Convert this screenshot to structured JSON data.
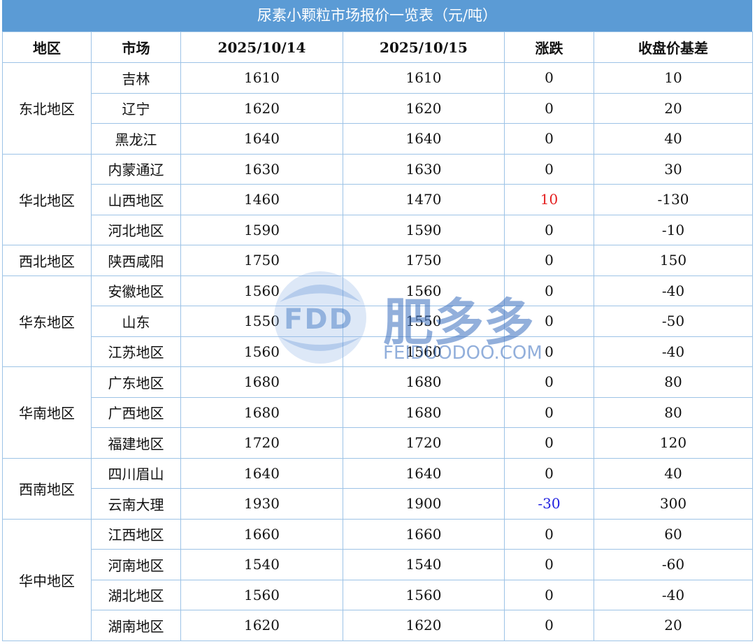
{
  "title": "尿素小颗粒市场报价一览表（元/吨）",
  "headers": [
    "地区",
    "市场",
    "2025/10/14",
    "2025/10/15",
    "涨跌",
    "收盘价基差"
  ],
  "groups": [
    {
      "region": "东北地区",
      "rows": [
        {
          "market": "吉林",
          "d1": "1610",
          "d2": "1610",
          "change": "0",
          "basis": "10"
        },
        {
          "market": "辽宁",
          "d1": "1620",
          "d2": "1620",
          "change": "0",
          "basis": "20"
        },
        {
          "market": "黑龙江",
          "d1": "1640",
          "d2": "1640",
          "change": "0",
          "basis": "40"
        }
      ]
    },
    {
      "region": "华北地区",
      "rows": [
        {
          "market": "内蒙通辽",
          "d1": "1630",
          "d2": "1630",
          "change": "0",
          "basis": "30"
        },
        {
          "market": "山西地区",
          "d1": "1460",
          "d2": "1470",
          "change": "10",
          "basis": "-130"
        },
        {
          "market": "河北地区",
          "d1": "1590",
          "d2": "1590",
          "change": "0",
          "basis": "-10"
        }
      ]
    },
    {
      "region": "西北地区",
      "rows": [
        {
          "market": "陕西咸阳",
          "d1": "1750",
          "d2": "1750",
          "change": "0",
          "basis": "150"
        }
      ]
    },
    {
      "region": "华东地区",
      "rows": [
        {
          "market": "安徽地区",
          "d1": "1560",
          "d2": "1560",
          "change": "0",
          "basis": "-40"
        },
        {
          "market": "山东",
          "d1": "1550",
          "d2": "1550",
          "change": "0",
          "basis": "-50"
        },
        {
          "market": "江苏地区",
          "d1": "1560",
          "d2": "1560",
          "change": "0",
          "basis": "-40"
        }
      ]
    },
    {
      "region": "华南地区",
      "rows": [
        {
          "market": "广东地区",
          "d1": "1680",
          "d2": "1680",
          "change": "0",
          "basis": "80"
        },
        {
          "market": "广西地区",
          "d1": "1680",
          "d2": "1680",
          "change": "0",
          "basis": "80"
        },
        {
          "market": "福建地区",
          "d1": "1720",
          "d2": "1720",
          "change": "0",
          "basis": "120"
        }
      ]
    },
    {
      "region": "西南地区",
      "rows": [
        {
          "market": "四川眉山",
          "d1": "1640",
          "d2": "1640",
          "change": "0",
          "basis": "40"
        },
        {
          "market": "云南大理",
          "d1": "1930",
          "d2": "1900",
          "change": "-30",
          "basis": "300"
        }
      ]
    },
    {
      "region": "华中地区",
      "rows": [
        {
          "market": "江西地区",
          "d1": "1660",
          "d2": "1660",
          "change": "0",
          "basis": "60"
        },
        {
          "market": "河南地区",
          "d1": "1540",
          "d2": "1540",
          "change": "0",
          "basis": "-60"
        },
        {
          "market": "湖北地区",
          "d1": "1560",
          "d2": "1560",
          "change": "0",
          "basis": "-40"
        },
        {
          "market": "湖南地区",
          "d1": "1620",
          "d2": "1620",
          "change": "0",
          "basis": "20"
        }
      ]
    }
  ],
  "watermark": {
    "logo": "FDD",
    "cn": "肥多多",
    "en": "FEIDUODOO.COM"
  },
  "colors": {
    "header_bg": "#5b9bd5",
    "border": "#9dc3e6",
    "up": "#e41e1e",
    "down": "#1f1fe0"
  }
}
